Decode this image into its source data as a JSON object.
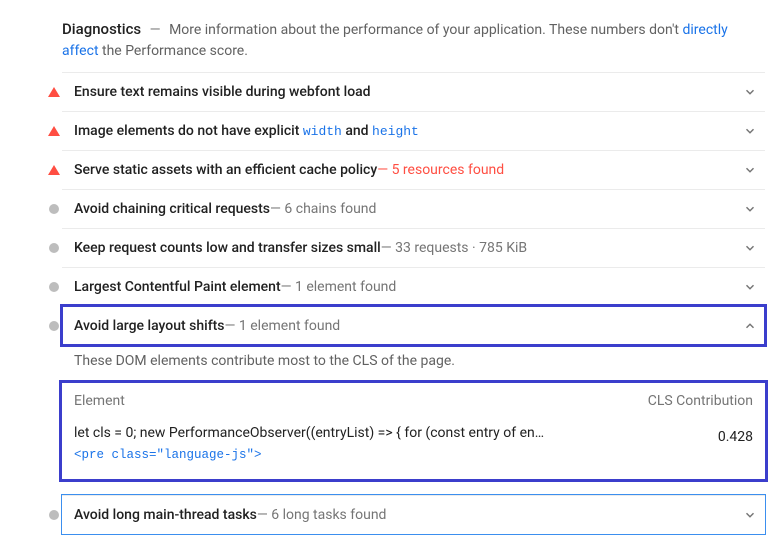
{
  "header": {
    "title": "Diagnostics",
    "dash": "—",
    "desc_prefix": "More information about the performance of your application. These numbers don't ",
    "link": "directly affect",
    "desc_suffix": " the Performance score."
  },
  "rows": [
    {
      "title": "Ensure text remains visible during webfont load"
    },
    {
      "title_prefix": "Image elements do not have explicit ",
      "code1": "width",
      "and": " and ",
      "code2": "height"
    },
    {
      "title": "Serve static assets with an efficient cache policy",
      "dash": " — ",
      "suffix": "5 resources found",
      "red": true
    },
    {
      "title": "Avoid chaining critical requests",
      "dash": " — ",
      "suffix": "6 chains found"
    },
    {
      "title": "Keep request counts low and transfer sizes small",
      "dash": " — ",
      "suffix": "33 requests · 785 KiB"
    },
    {
      "title": "Largest Contentful Paint element",
      "dash": " — ",
      "suffix": "1 element found"
    },
    {
      "title": "Avoid large layout shifts",
      "dash": " — ",
      "suffix": "1 element found"
    }
  ],
  "expanded": {
    "desc": "These DOM elements contribute most to the CLS of the page.",
    "col1": "Element",
    "col2": "CLS Contribution",
    "item_text": "let cls = 0; new PerformanceObserver((entryList) => { for (const entry of en…",
    "item_code": "<pre class=\"language-js\">",
    "item_value": "0.428"
  },
  "last_row": {
    "title": "Avoid long main-thread tasks",
    "dash": " — ",
    "suffix": "6 long tasks found"
  }
}
